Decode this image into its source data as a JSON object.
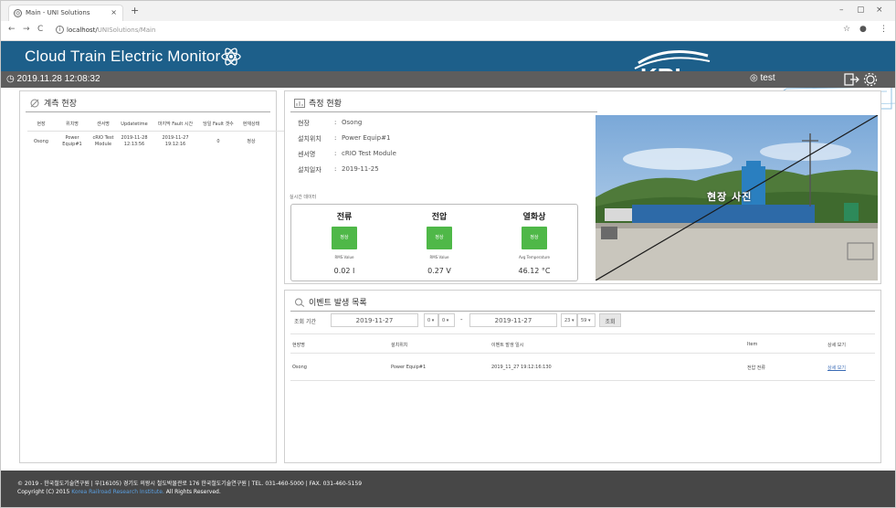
{
  "browser": {
    "tab_title": "Main - UNI Solutions",
    "tab_close": "×",
    "new_tab": "+",
    "url_host": "localhost/",
    "url_path": "UNISolutions/Main",
    "nav_back": "←",
    "nav_forward": "→",
    "nav_reload": "C",
    "window_controls": [
      "–",
      "▢",
      "×"
    ]
  },
  "header": {
    "title": "Cloud Train Electric Monitor",
    "datetime": "2019.11.28 12:08:32",
    "logo_text": "KRI",
    "user_name": "test"
  },
  "measure_site_panel": {
    "title": "계측 현장",
    "columns": [
      "현장",
      "위치명",
      "센서명",
      "Updatetime",
      "마지막 Fault 시간",
      "당일 Fault 갯수",
      "현재상태"
    ],
    "rows": [
      [
        "Osong",
        "Power Equip#1",
        "cRIO Test Module",
        "2019-11-28 12:13:56",
        "2019-11-27 19:12:16",
        "0",
        "정상"
      ]
    ]
  },
  "measure_status_panel": {
    "title": "측정 현황",
    "info": [
      {
        "key": "현장",
        "sep": ":",
        "value": "Osong"
      },
      {
        "key": "설치위치",
        "sep": ":",
        "value": "Power Equip#1"
      },
      {
        "key": "센서명",
        "sep": ":",
        "value": "cRIO Test Module"
      },
      {
        "key": "설치일자",
        "sep": ":",
        "value": "2019-11-25"
      }
    ],
    "realtime_label": "실시간 데이터",
    "realtime": [
      {
        "name": "전류",
        "status": "정상",
        "caption": "RMS Value",
        "value": "0.02 I"
      },
      {
        "name": "전압",
        "status": "정상",
        "caption": "RMS Value",
        "value": "0.27 V"
      },
      {
        "name": "열화상",
        "status": "정상",
        "caption": "Avg Temperature",
        "value": "46.12 °C"
      }
    ],
    "photo_label": "현장 사진"
  },
  "event_panel": {
    "title": "이벤트 발생 목록",
    "filter_label": "조회 기간",
    "date_from": "2019-11-27",
    "hour_from": "0",
    "min_from": "0",
    "range_sep": "-",
    "date_to": "2019-11-27",
    "hour_to": "23",
    "min_to": "59",
    "search_button": "조회",
    "columns": [
      "현장명",
      "설치위치",
      "이벤트 발생 일시",
      "Item",
      "상세 보기"
    ],
    "rows": [
      [
        "Osong",
        "Power Equip#1",
        "2019_11_27 19:12:16:130",
        "전압 전류",
        "상세 보기"
      ]
    ]
  },
  "footer": {
    "line1": "© 2019 - 한국철도기술연구원 | 우(16105) 경기도 의왕시 철도박물관로 176 한국철도기술연구원 | TEL. 031-460-5000 | FAX. 031-460-5159",
    "line2_prefix": "Copyright (C) 2015",
    "line2_link": "Korea Railroad Research Institute.",
    "line2_suffix": "All Rights Reserved."
  },
  "colors": {
    "header_blue": "#1d5f8a",
    "subbar_gray": "#5d5d5d",
    "status_green": "#4fb848",
    "footer_gray": "#474747"
  }
}
